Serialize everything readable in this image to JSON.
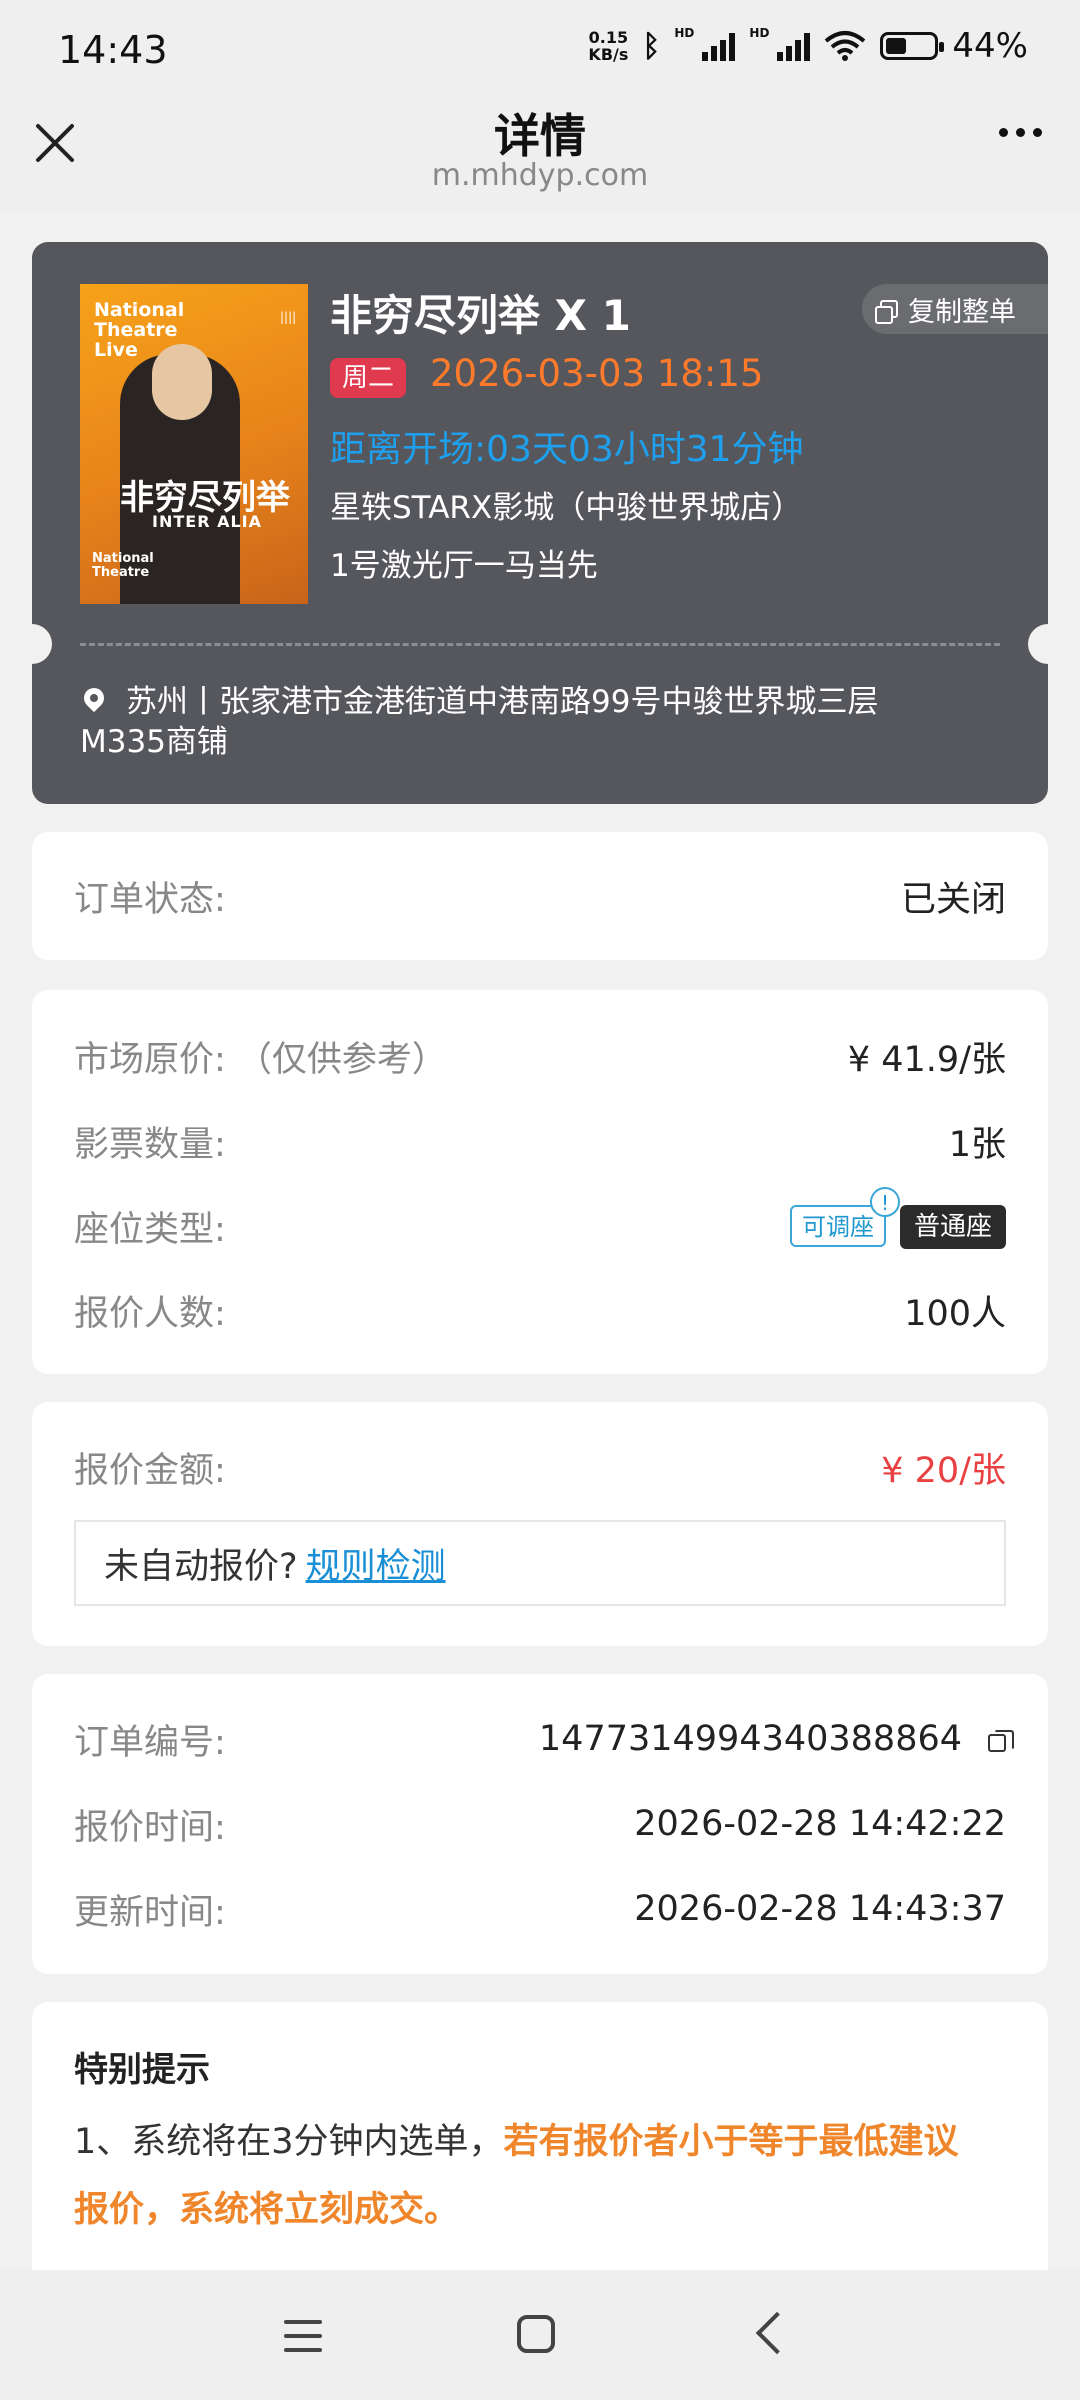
{
  "status_bar": {
    "time": "14:43",
    "net_speed_value": "0.15",
    "net_speed_unit": "KB/s",
    "hd1": "HD",
    "hd2": "HD",
    "battery_percent": "44%",
    "battery_level": 0.44
  },
  "header": {
    "title": "详情",
    "url": "m.mhdyp.com"
  },
  "ticket": {
    "poster": {
      "brand_line1": "National",
      "brand_line2": "Theatre",
      "brand_line3": "Live",
      "title": "非穷尽列举",
      "subtitle": "INTER ALIA",
      "footer_line1": "National",
      "footer_line2": "Theatre"
    },
    "movie_title": "非穷尽列举  X 1",
    "copy_order_label": "复制整单",
    "weekday": "周二",
    "showtime": "2026-03-03 18:15",
    "countdown": "距离开场:03天03小时31分钟",
    "cinema": "星轶STARX影城（中骏世界城店）",
    "hall": "1号激光厅一马当先",
    "address": "苏州丨张家港市金港街道中港南路99号中骏世界城三层M335商铺"
  },
  "order_status": {
    "label": "订单状态:",
    "value": "已关闭"
  },
  "details": {
    "market_price_label": "市场原价: （仅供参考）",
    "market_price_value": "¥ 41.9/张",
    "ticket_count_label": "影票数量:",
    "ticket_count_value": "1张",
    "seat_type_label": "座位类型:",
    "seat_tag_adjustable": "可调座",
    "seat_tag_info": "!",
    "seat_tag_normal": "普通座",
    "bidders_label": "报价人数:",
    "bidders_value": "100人"
  },
  "quote": {
    "amount_label": "报价金额:",
    "amount_value": "¥ 20/张",
    "auto_quote_text": "未自动报价?",
    "rule_check_link": "规则检测"
  },
  "order_info": {
    "order_no_label": "订单编号:",
    "order_no_value": "1477314994340388864",
    "quote_time_label": "报价时间:",
    "quote_time_value": "2026-02-28 14:42:22",
    "update_time_label": "更新时间:",
    "update_time_value": "2026-02-28 14:43:37"
  },
  "notice": {
    "title": "特别提示",
    "item1_prefix": "1、系统将在3分钟内选单，",
    "item1_highlight": "若有报价者小于等于最低建议报价，系统将立刻成交。"
  }
}
